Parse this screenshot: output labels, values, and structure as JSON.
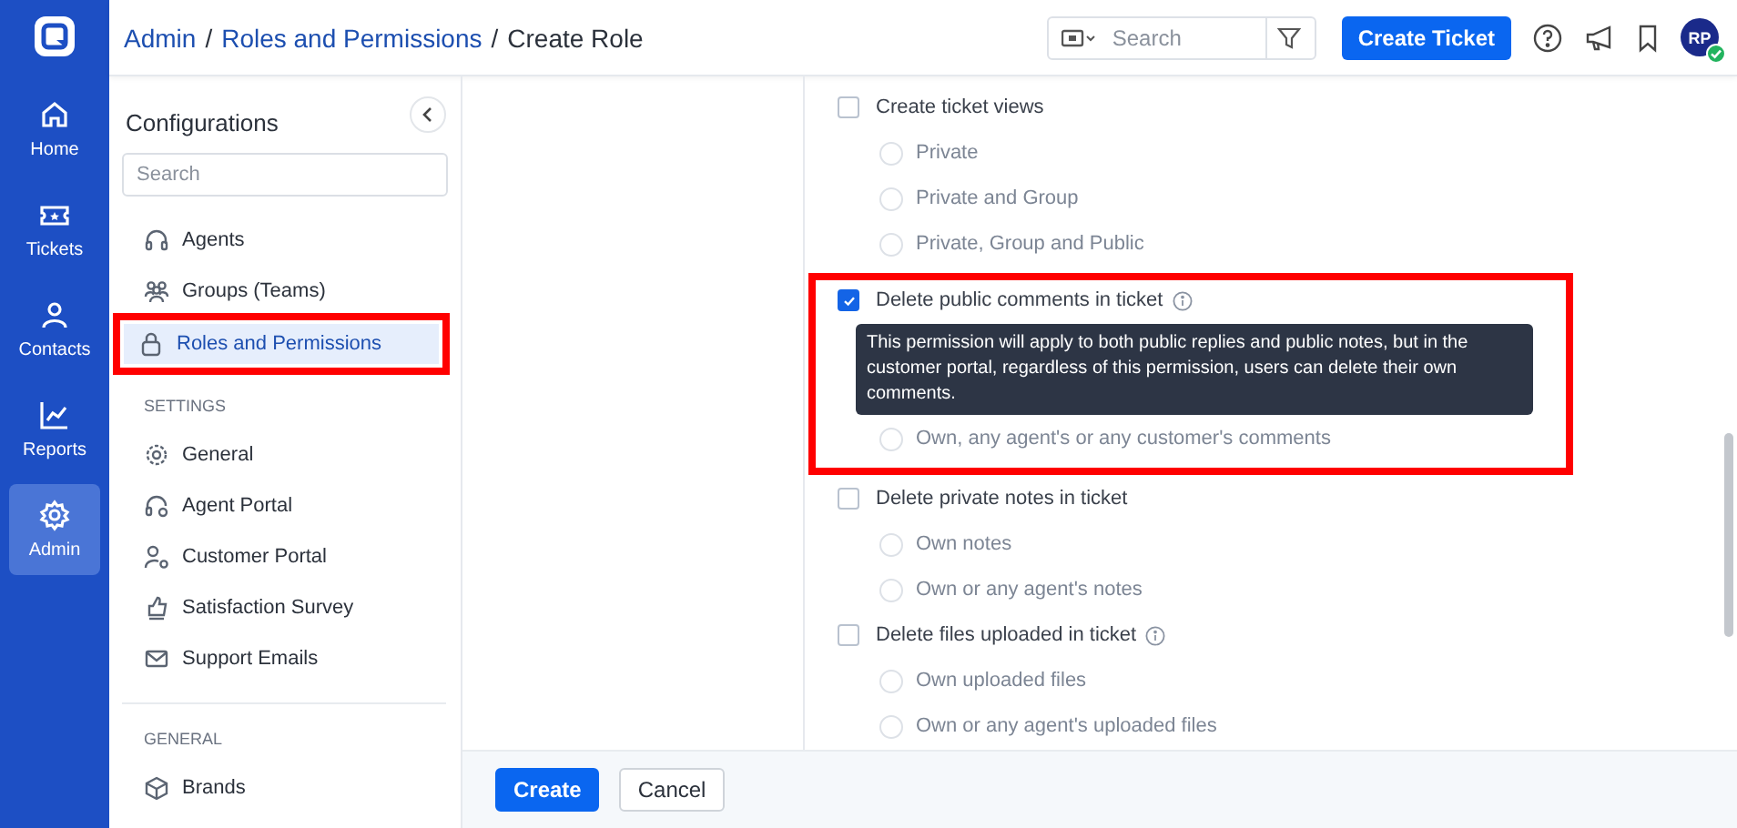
{
  "rail": {
    "items": [
      {
        "kind": "home",
        "label": "Home",
        "selected": false
      },
      {
        "kind": "tickets",
        "label": "Tickets",
        "selected": false
      },
      {
        "kind": "contacts",
        "label": "Contacts",
        "selected": false
      },
      {
        "kind": "reports",
        "label": "Reports",
        "selected": false
      },
      {
        "kind": "admin",
        "label": "Admin",
        "selected": true
      }
    ]
  },
  "topbar": {
    "breadcrumb": [
      {
        "label": "Admin",
        "link": true
      },
      {
        "label": "Roles and Permissions",
        "link": true
      },
      {
        "label": "Create Role",
        "link": false
      }
    ],
    "separator": "/",
    "search": {
      "placeholder": "Search"
    },
    "create_button": "Create Ticket",
    "avatar": {
      "initials": "RP",
      "online": true
    }
  },
  "sidebar": {
    "title": "Configurations",
    "search": {
      "placeholder": "Search"
    },
    "sections": [
      {
        "items": [
          {
            "kind": "headset",
            "label": "Agents",
            "selected": false,
            "highlighted": false
          },
          {
            "kind": "group",
            "label": "Groups (Teams)",
            "selected": false,
            "highlighted": false
          },
          {
            "kind": "lock",
            "label": "Roles and Permissions",
            "selected": true,
            "highlighted": true
          }
        ]
      },
      {
        "heading": "SETTINGS",
        "items": [
          {
            "kind": "gear",
            "label": "General",
            "selected": false,
            "highlighted": false
          },
          {
            "kind": "headset-gear",
            "label": "Agent Portal",
            "selected": false,
            "highlighted": false
          },
          {
            "kind": "person-gear",
            "label": "Customer Portal",
            "selected": false,
            "highlighted": false
          },
          {
            "kind": "thumb",
            "label": "Satisfaction Survey",
            "selected": false,
            "highlighted": false
          },
          {
            "kind": "mail",
            "label": "Support Emails",
            "selected": false,
            "highlighted": false
          }
        ]
      },
      {
        "heading": "GENERAL",
        "items": [
          {
            "kind": "cube",
            "label": "Brands",
            "selected": false,
            "highlighted": false
          }
        ]
      }
    ]
  },
  "permissions": [
    {
      "label": "Create ticket views",
      "checked": false,
      "info": false,
      "highlighted": false,
      "options": [
        {
          "label": "Private",
          "selected": false
        },
        {
          "label": "Private and Group",
          "selected": false
        },
        {
          "label": "Private, Group and Public",
          "selected": false
        }
      ]
    },
    {
      "label": "Delete public comments in ticket",
      "checked": true,
      "info": true,
      "highlighted": true,
      "tooltip": "This permission will apply to both public replies and public notes, but in the customer portal, regardless of this permission, users can delete their own comments.",
      "options": [
        {
          "label": "Own, any agent's or any customer's comments",
          "selected": false
        }
      ]
    },
    {
      "label": "Delete private notes in ticket",
      "checked": false,
      "info": false,
      "highlighted": false,
      "options": [
        {
          "label": "Own notes",
          "selected": false
        },
        {
          "label": "Own or any agent's notes",
          "selected": false
        }
      ]
    },
    {
      "label": "Delete files uploaded in ticket",
      "checked": false,
      "info": true,
      "highlighted": false,
      "options": [
        {
          "label": "Own uploaded files",
          "selected": false
        },
        {
          "label": "Own or any agent's uploaded files",
          "selected": false
        }
      ]
    }
  ],
  "footer": {
    "buttons": [
      {
        "label": "Create",
        "kind": "primary"
      },
      {
        "label": "Cancel",
        "kind": "secondary"
      }
    ]
  }
}
